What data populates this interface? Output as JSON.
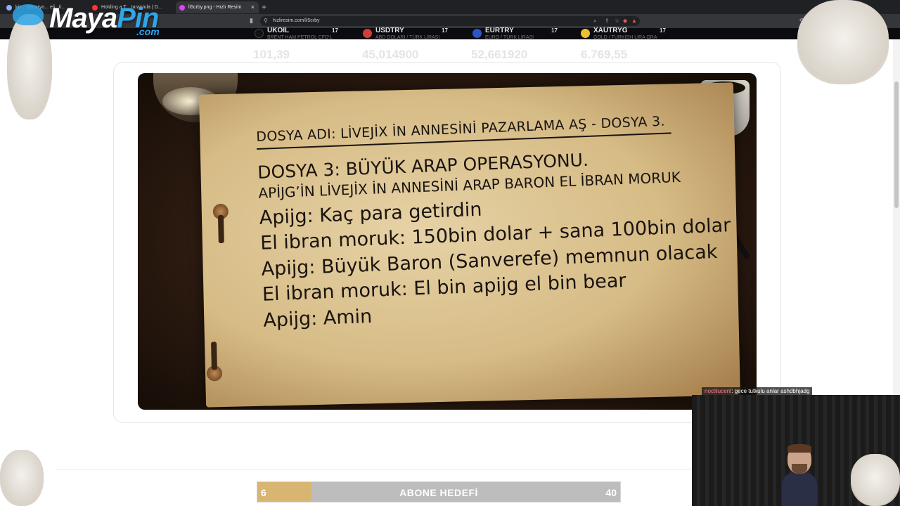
{
  "browser": {
    "tabs": [
      {
        "title": "kiz... senaryo... eli.. ti...",
        "color": "#8ab4f8",
        "active": false
      },
      {
        "title": "Holding a T... tarantula | D...",
        "color": "#ff3333",
        "active": false
      },
      {
        "title": "li5crby.png - Hızlı Resim",
        "color": "#e040fb",
        "active": true
      }
    ],
    "close_glyph": "×",
    "newtab_glyph": "+",
    "url": "hizliresim.com/li5crby"
  },
  "logo": {
    "maya": "Maya",
    "pin": "Pin",
    "com": ".com"
  },
  "ticker": [
    {
      "symbol": "UKOIL",
      "desc": "BRENT HAM PETROL CFD'L",
      "price": "101,39",
      "icon": "oil-drop-icon",
      "color": "#111111"
    },
    {
      "symbol": "USDTRY",
      "desc": "ABD DOLARI / TÜRK LİRASI",
      "price": "45,014900",
      "icon": "usd-flag-icon",
      "color": "#d33c3c"
    },
    {
      "symbol": "EURTRY",
      "desc": "EURO / TÜRK LİRASI",
      "price": "52,661920",
      "icon": "eur-flag-icon",
      "color": "#2a56c6"
    },
    {
      "symbol": "XAUTRYG",
      "desc": "GOLD / TURKISH LIRA GRA",
      "price": "6.769,55",
      "icon": "gold-coin-icon",
      "color": "#e8c232"
    }
  ],
  "tradingview_mark": "17",
  "document": {
    "title_line": "DOSYA ADI: LİVEJİX İN ANNESİNİ PAZARLAMA AŞ - DOSYA 3.",
    "heading": "DOSYA 3: BÜYÜK ARAP OPERASYONU.",
    "subheading": "APİJG’İN LİVEJİX İN ANNESİNİ ARAP BARON EL İBRAN MORUK",
    "lines": [
      "Apijg: Kaç para getirdin",
      "El ibran moruk: 150bin dolar + sana 100bin dolar",
      "Apijg: Büyük Baron (Sanverefe) memnun olacak",
      "El ibran moruk: El bin apijg el bin bear",
      "Apijg: Amin"
    ]
  },
  "chat": {
    "user": "noctilucent",
    "message": ": gece tutkulu anlar ashdbhjadg"
  },
  "sub_goal": {
    "label": "ABONE HEDEFİ",
    "current": "6",
    "target": "40",
    "progress": 0.15
  }
}
